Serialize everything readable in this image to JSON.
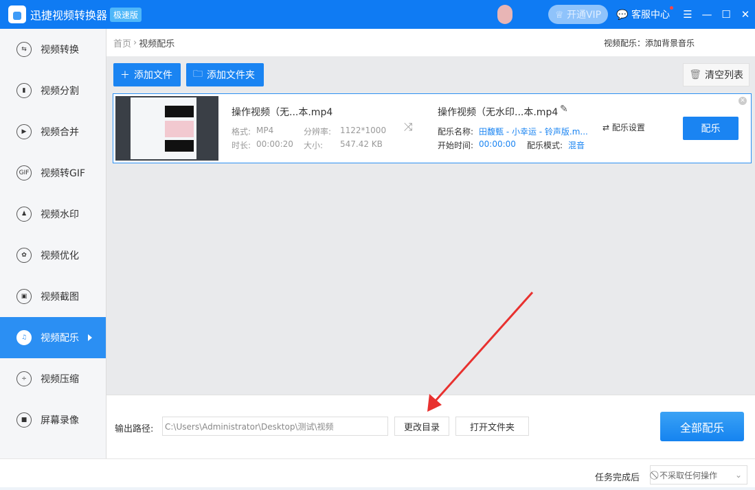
{
  "app": {
    "title": "迅捷视频转换器",
    "edition": "极速版",
    "vip": "开通VIP",
    "service": "客服中心"
  },
  "sidebar": {
    "items": [
      {
        "label": "视频转换",
        "icon": "⇆"
      },
      {
        "label": "视频分割",
        "icon": "▮"
      },
      {
        "label": "视频合并",
        "icon": "▶"
      },
      {
        "label": "视频转GIF",
        "icon": "GIF"
      },
      {
        "label": "视频水印",
        "icon": "♟"
      },
      {
        "label": "视频优化",
        "icon": "✿"
      },
      {
        "label": "视频截图",
        "icon": "▣"
      },
      {
        "label": "视频配乐",
        "icon": "♫",
        "active": true
      },
      {
        "label": "视频压缩",
        "icon": "÷"
      },
      {
        "label": "屏幕录像",
        "icon": "■"
      }
    ]
  },
  "breadcrumb": {
    "home": "首页",
    "sep": "›",
    "current": "视频配乐",
    "right": "视频配乐：添加背景音乐"
  },
  "toolbar": {
    "add_file": "添加文件",
    "add_folder": "添加文件夹",
    "clear": "清空列表"
  },
  "file": {
    "name": "操作视频（无...本.mp4",
    "format_label": "格式:",
    "format": "MP4",
    "res_label": "分辨率:",
    "res": "1122*1000",
    "dur_label": "时长:",
    "dur": "00:00:20",
    "size_label": "大小:",
    "size": "547.42 KB",
    "out_name": "操作视频（无水印...本.mp4",
    "music_label": "配乐名称:",
    "music": "田馥甄 - 小幸运 - 铃声版.m...",
    "start_label": "开始时间:",
    "start": "00:00:00",
    "mode_label": "配乐模式:",
    "mode": "混音",
    "settings": "配乐设置",
    "action": "配乐"
  },
  "output": {
    "label": "输出路径:",
    "path": "C:\\Users\\Administrator\\Desktop\\测试\\视频",
    "change": "更改目录",
    "open": "打开文件夹",
    "all": "全部配乐"
  },
  "footer": {
    "after_label": "任务完成后",
    "after_value": "不采取任何操作"
  }
}
